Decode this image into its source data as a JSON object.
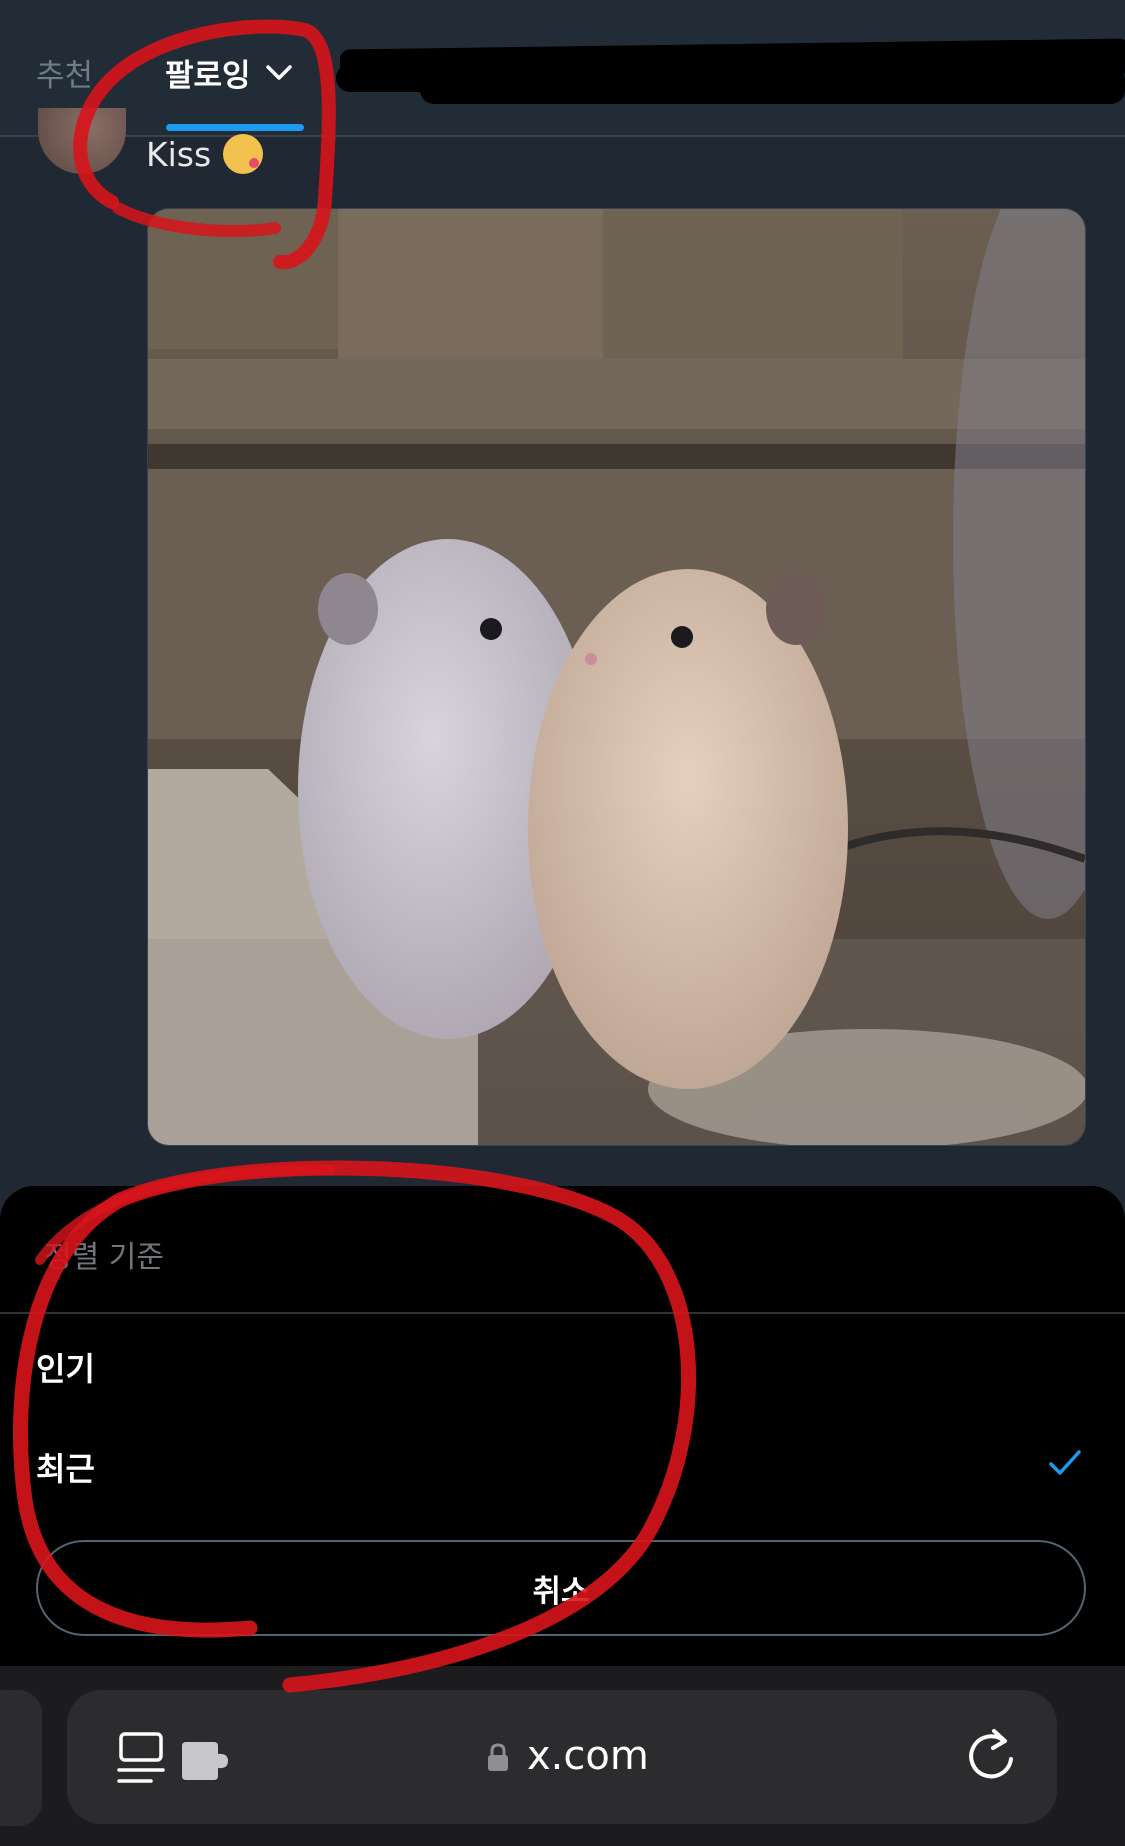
{
  "header": {
    "tab_recommended": "추천",
    "tab_following": "팔로잉"
  },
  "post": {
    "text": "Kiss",
    "emoji_icon": "kissing-face-icon",
    "image_description_icon": "photo"
  },
  "sort_sheet": {
    "title": "정렬 기준",
    "options": [
      {
        "label": "인기",
        "selected": false
      },
      {
        "label": "최근",
        "selected": true
      }
    ],
    "cancel_label": "취소"
  },
  "browser": {
    "url": "x.com"
  },
  "colors": {
    "accent": "#1d9bf0",
    "annotation": "#e3141b"
  }
}
